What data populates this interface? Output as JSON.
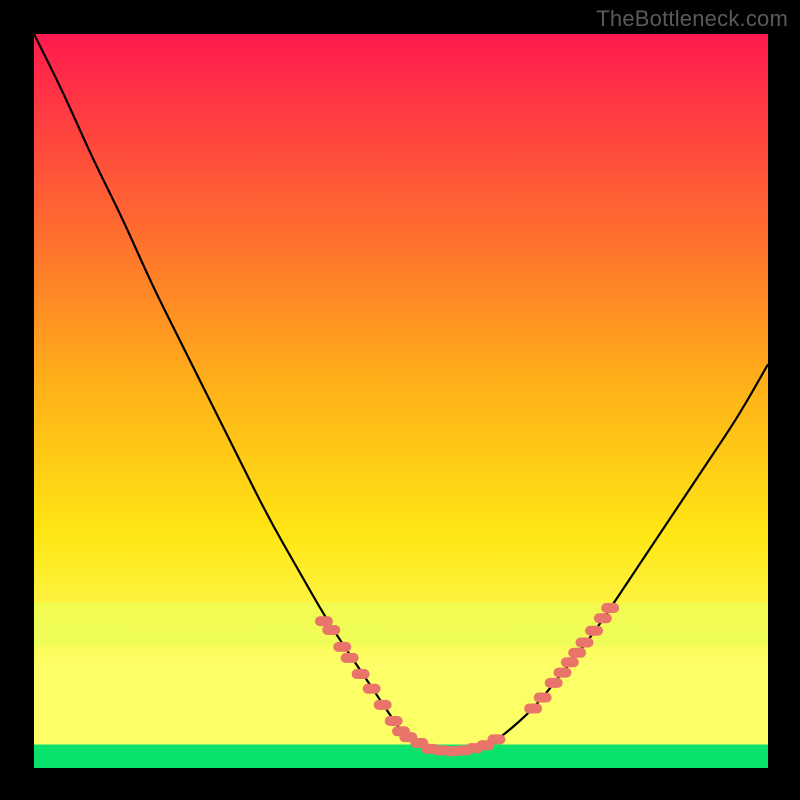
{
  "watermark": "TheBottleneck.com",
  "colors": {
    "bg": "#000000",
    "grad_top": "#ff1a4f",
    "grad_mid1": "#ff6a30",
    "grad_mid2": "#ffb118",
    "grad_mid3": "#ffe614",
    "grad_low": "#fdff67",
    "grad_band": "#e8ff5a",
    "grad_bottom": "#09e36b",
    "curve": "#000000",
    "marker": "#e9756a"
  },
  "chart_data": {
    "type": "line",
    "title": "",
    "xlabel": "",
    "ylabel": "",
    "xlim": [
      0,
      100
    ],
    "ylim": [
      0,
      100
    ],
    "series": [
      {
        "name": "bottleneck-curve",
        "x": [
          0,
          4,
          8,
          12,
          16,
          20,
          24,
          28,
          32,
          36,
          40,
          44,
          48,
          50,
          52,
          54,
          56,
          58,
          60,
          62,
          64,
          68,
          72,
          76,
          80,
          84,
          88,
          92,
          96,
          100
        ],
        "y": [
          100,
          92,
          83,
          75,
          66,
          58,
          50,
          42,
          34,
          27,
          20,
          14,
          8,
          5,
          3.5,
          2.6,
          2.3,
          2.3,
          2.5,
          3.2,
          4.5,
          8,
          13,
          18,
          24,
          30,
          36,
          42,
          48,
          55
        ]
      }
    ],
    "markers": [
      {
        "name": "left-cluster",
        "points": [
          {
            "x": 39.5,
            "y": 20.0
          },
          {
            "x": 40.5,
            "y": 18.8
          },
          {
            "x": 42.0,
            "y": 16.5
          },
          {
            "x": 43.0,
            "y": 15.0
          },
          {
            "x": 44.5,
            "y": 12.8
          },
          {
            "x": 46.0,
            "y": 10.8
          },
          {
            "x": 47.5,
            "y": 8.6
          },
          {
            "x": 49.0,
            "y": 6.4
          }
        ]
      },
      {
        "name": "valley-cluster",
        "points": [
          {
            "x": 50.0,
            "y": 5.0
          },
          {
            "x": 51.0,
            "y": 4.2
          },
          {
            "x": 52.5,
            "y": 3.4
          },
          {
            "x": 54.0,
            "y": 2.6
          },
          {
            "x": 55.5,
            "y": 2.4
          },
          {
            "x": 57.0,
            "y": 2.3
          },
          {
            "x": 58.5,
            "y": 2.4
          },
          {
            "x": 60.0,
            "y": 2.7
          },
          {
            "x": 61.5,
            "y": 3.1
          },
          {
            "x": 63.0,
            "y": 3.9
          }
        ]
      },
      {
        "name": "right-cluster",
        "points": [
          {
            "x": 68.0,
            "y": 8.1
          },
          {
            "x": 69.3,
            "y": 9.6
          },
          {
            "x": 70.8,
            "y": 11.6
          },
          {
            "x": 72.0,
            "y": 13.0
          },
          {
            "x": 73.0,
            "y": 14.4
          },
          {
            "x": 74.0,
            "y": 15.7
          },
          {
            "x": 75.0,
            "y": 17.1
          },
          {
            "x": 76.3,
            "y": 18.7
          },
          {
            "x": 77.5,
            "y": 20.4
          },
          {
            "x": 78.5,
            "y": 21.8
          }
        ]
      }
    ],
    "bands": [
      {
        "name": "pale-band",
        "y0": 16.5,
        "y1": 22.5
      },
      {
        "name": "green-band",
        "y0": 0,
        "y1": 3.2
      }
    ]
  }
}
